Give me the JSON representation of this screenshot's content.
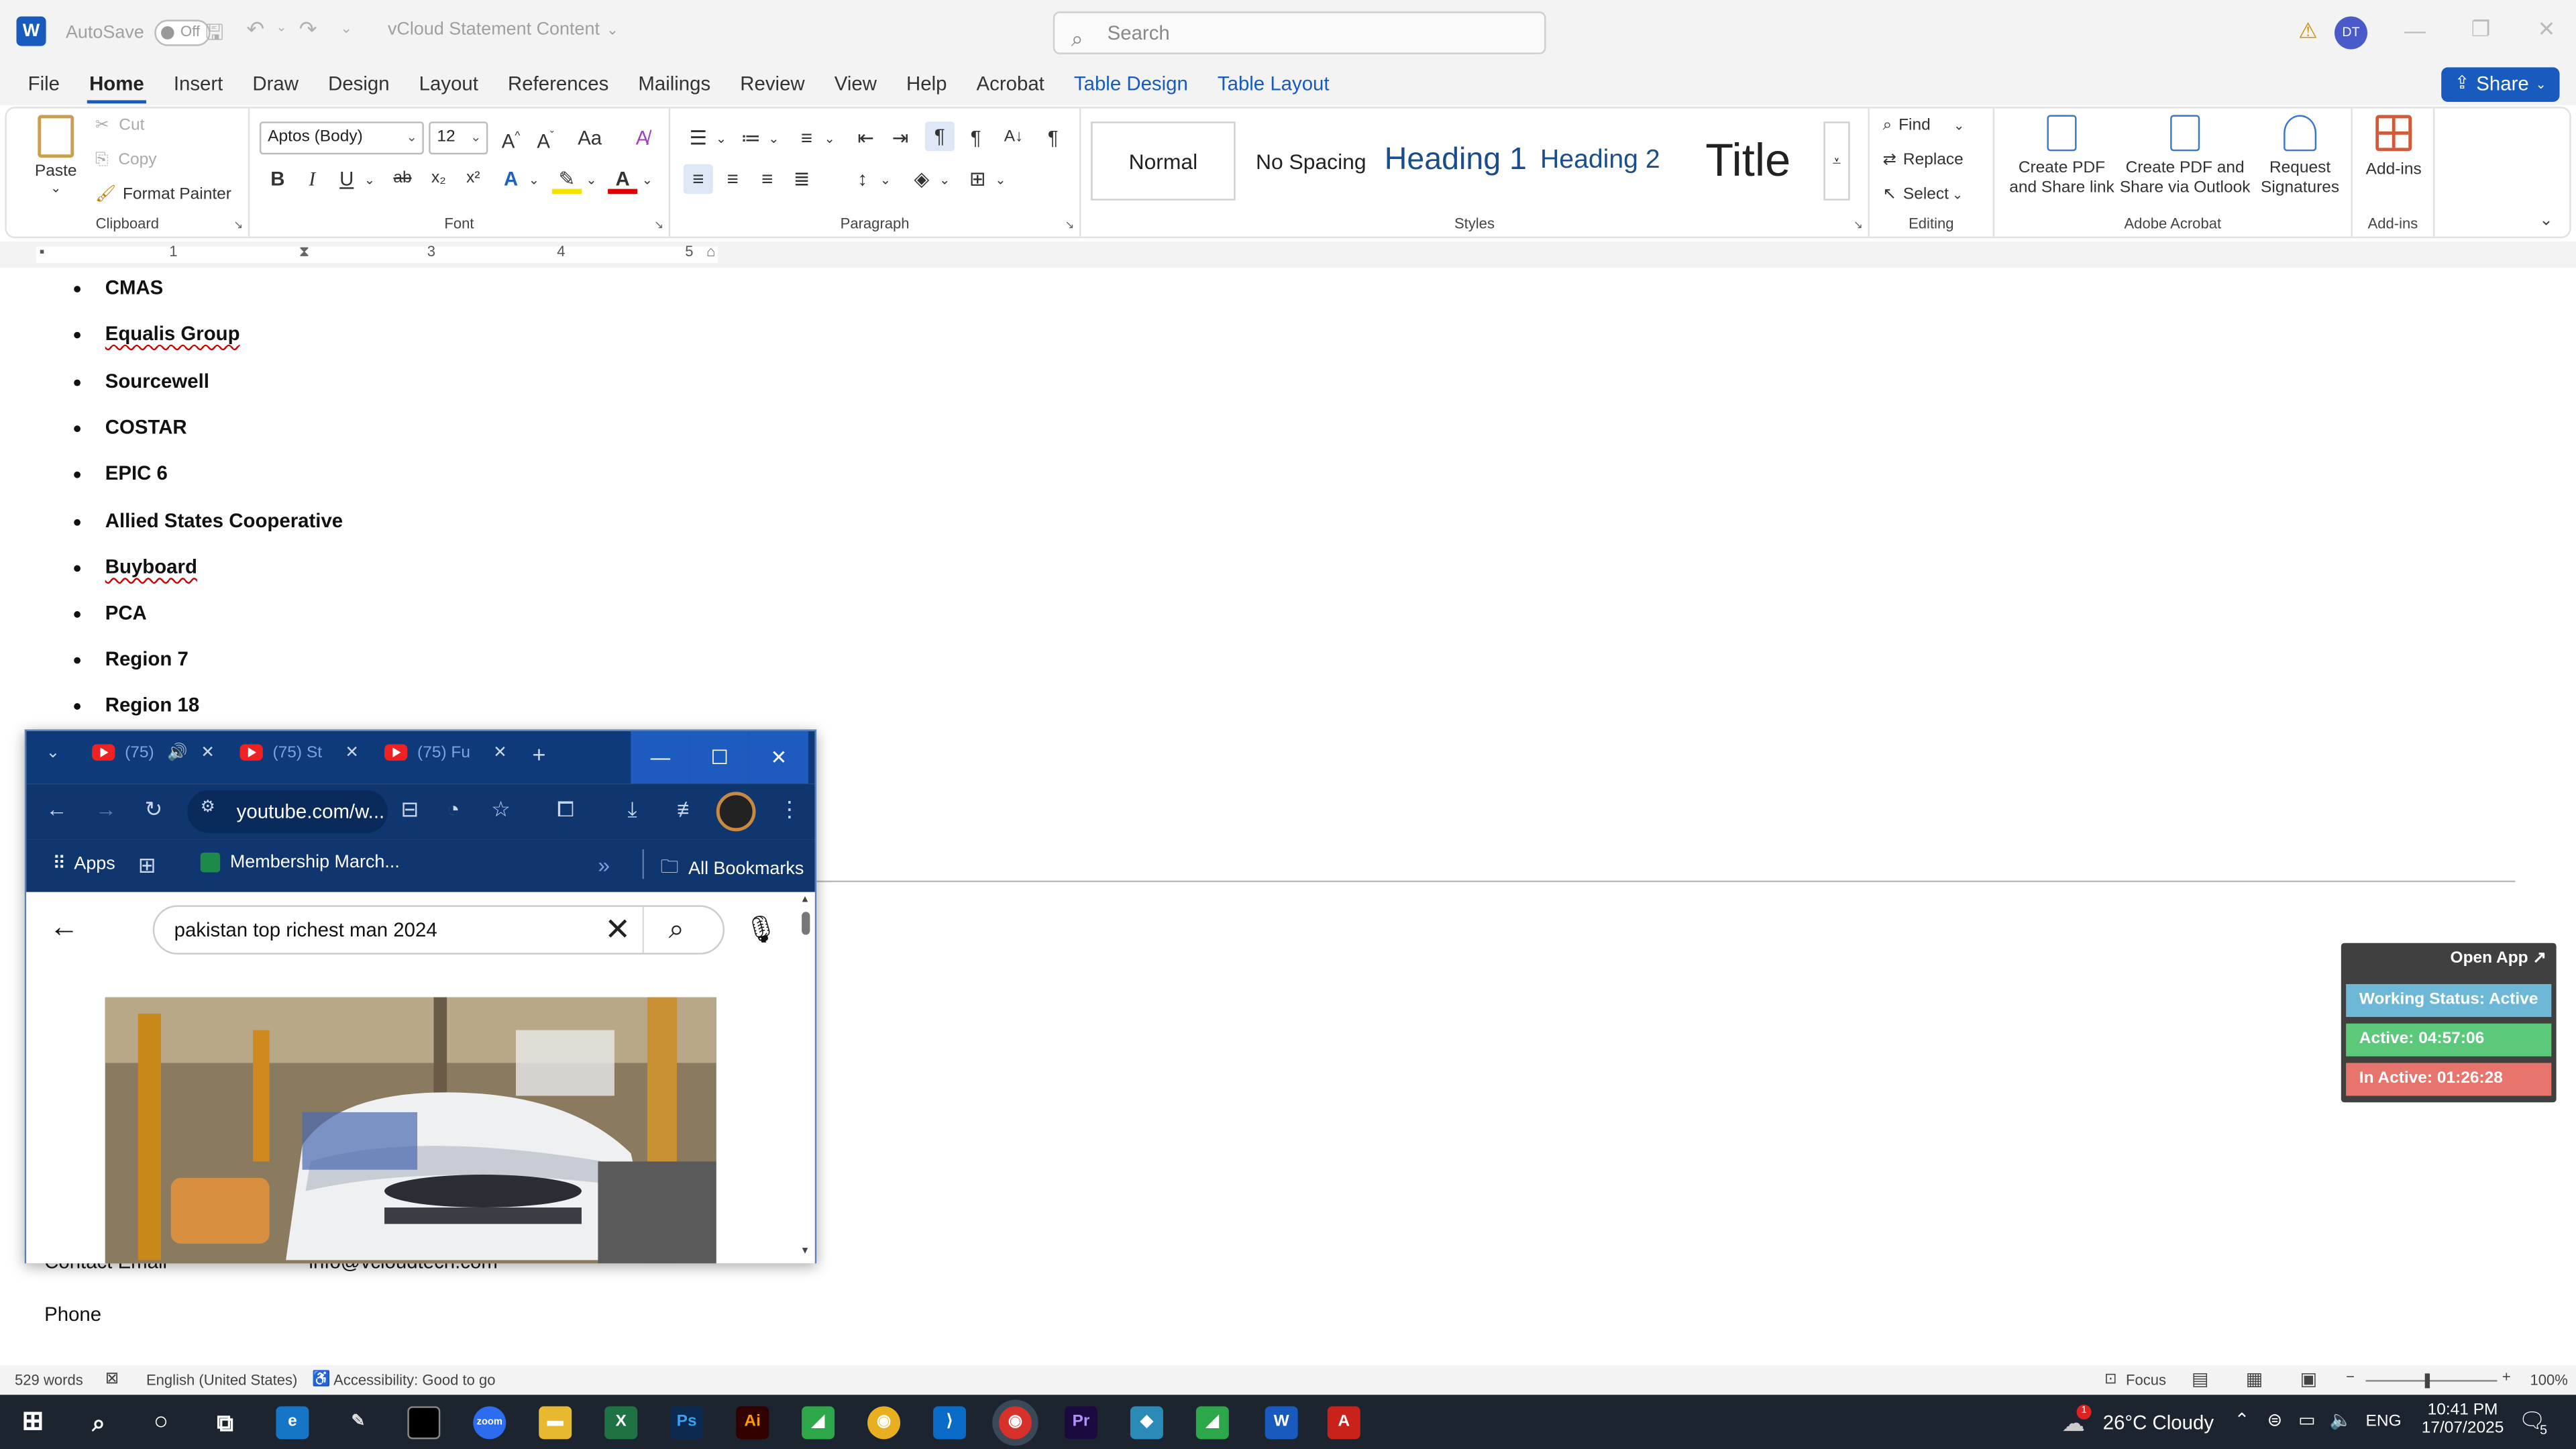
{
  "titlebar": {
    "autosave_label": "AutoSave",
    "toggle_state": "Off",
    "doc_title": "vCloud Statement Content",
    "search_placeholder": "Search",
    "avatar_initials": "DT"
  },
  "menu": {
    "items": [
      "File",
      "Home",
      "Insert",
      "Draw",
      "Design",
      "Layout",
      "References",
      "Mailings",
      "Review",
      "View",
      "Help",
      "Acrobat",
      "Table Design",
      "Table Layout"
    ],
    "active": "Home",
    "share_label": "Share"
  },
  "ribbon": {
    "clipboard": {
      "paste": "Paste",
      "cut": "Cut",
      "copy": "Copy",
      "format_painter": "Format Painter",
      "label": "Clipboard"
    },
    "font": {
      "name": "Aptos (Body)",
      "size": "12",
      "label": "Font"
    },
    "paragraph": {
      "label": "Paragraph"
    },
    "styles": {
      "items": [
        "Normal",
        "No Spacing",
        "Heading 1",
        "Heading 2",
        "Title"
      ],
      "label": "Styles"
    },
    "editing": {
      "find": "Find",
      "replace": "Replace",
      "select": "Select",
      "label": "Editing"
    },
    "acrobat": {
      "create_pdf_share": "Create PDF and Share link",
      "create_pdf_outlook": "Create PDF and Share via Outlook",
      "request_sig": "Request Signatures",
      "label": "Adobe Acrobat"
    },
    "addins": {
      "button": "Add-ins",
      "label": "Add-ins"
    }
  },
  "ruler": {
    "numbers": [
      "1",
      "1",
      "2",
      "3",
      "4",
      "5"
    ]
  },
  "document": {
    "list_items": [
      "CMAS",
      "Equalis Group",
      "Sourcewell",
      "COSTAR",
      "EPIC 6",
      "Allied States Cooperative",
      "Buyboard",
      "PCA",
      "Region 7",
      "Region 18"
    ],
    "contact_label": "Contact Email",
    "contact_value": "info@vcloudtech.com",
    "phone_label": "Phone"
  },
  "tracker": {
    "open_app": "Open App ↗",
    "working_status": "Working Status: Active",
    "active": "Active: 04:57:06",
    "inactive": "In Active: 01:26:28",
    "colors": {
      "status": "#6cb8d6",
      "active": "#5cc87a",
      "inactive": "#e8746e"
    }
  },
  "chrome": {
    "tabs": [
      "(75)",
      "(75) St",
      "(75) Fu"
    ],
    "url": "youtube.com/w...",
    "bookmarks": {
      "apps": "Apps",
      "membership": "Membership March...",
      "all": "All Bookmarks"
    },
    "search_query": "pakistan top richest man 2024"
  },
  "statusbar": {
    "words": "529 words",
    "language": "English (United States)",
    "accessibility": "Accessibility: Good to go",
    "focus": "Focus",
    "zoom": "100%"
  },
  "taskbar": {
    "weather": "26°C Cloudy",
    "lang": "ENG",
    "time": "10:41 PM",
    "date": "17/07/2025",
    "notif_count": "5",
    "weather_badge": "1"
  }
}
